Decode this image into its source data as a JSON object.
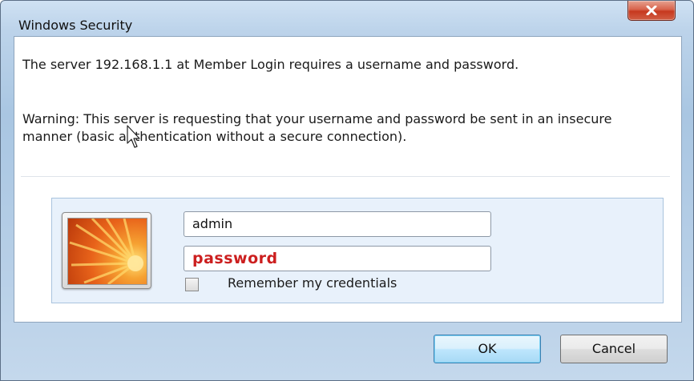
{
  "window": {
    "title": "Windows Security",
    "close_icon": "close-x-icon"
  },
  "message": {
    "line1": "The server 192.168.1.1 at Member Login requires a username and password.",
    "warning": "Warning: This server is requesting that your username and password be sent in an insecure manner (basic authentication without a secure connection)."
  },
  "credentials": {
    "avatar_icon": "user-tile-flower-icon",
    "username_value": "admin",
    "password_value": "password",
    "remember_label": "Remember my credentials",
    "remember_checked": false
  },
  "buttons": {
    "ok_label": "OK",
    "cancel_label": "Cancel"
  },
  "colors": {
    "password_text": "#cc1f1f",
    "close_button": "#c6391f"
  }
}
